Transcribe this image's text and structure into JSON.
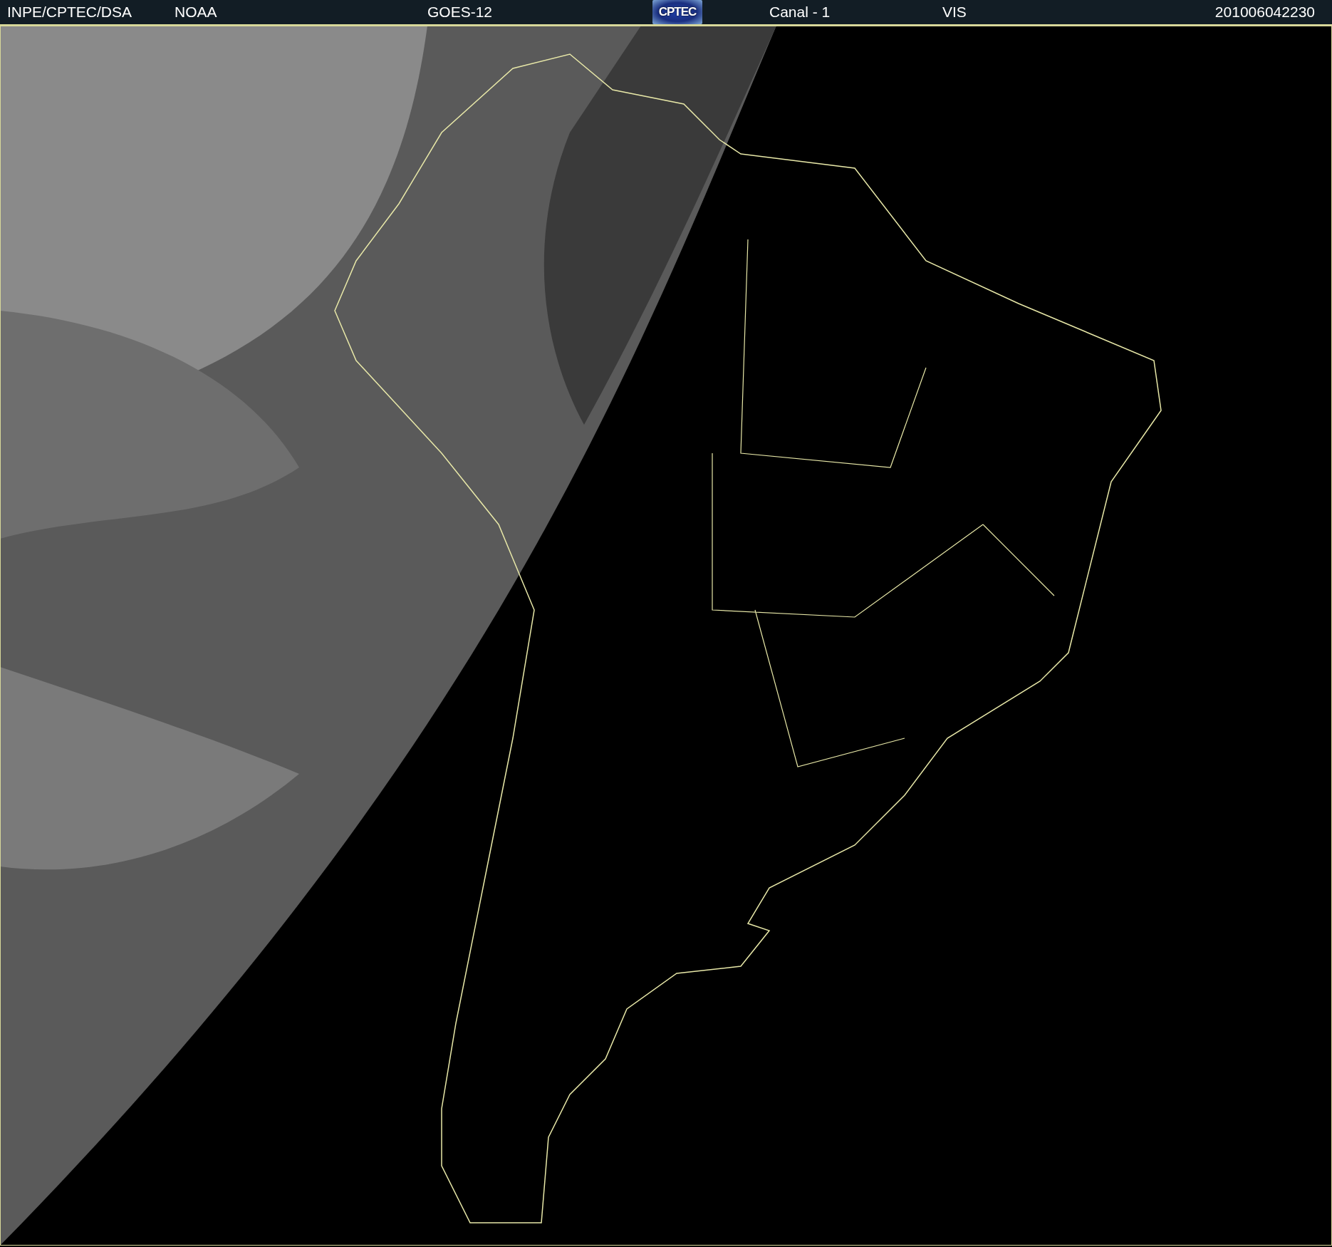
{
  "header": {
    "items": [
      {
        "kind": "text",
        "text": "INPE/CPTEC/DSA"
      },
      {
        "kind": "text",
        "text": "NOAA"
      },
      {
        "kind": "text",
        "text": "GOES-12"
      },
      {
        "kind": "logo",
        "text": "CPTEC"
      },
      {
        "kind": "text",
        "text": "Canal - 1"
      },
      {
        "kind": "text",
        "text": "VIS"
      },
      {
        "kind": "text",
        "text": "201006042230"
      }
    ]
  }
}
